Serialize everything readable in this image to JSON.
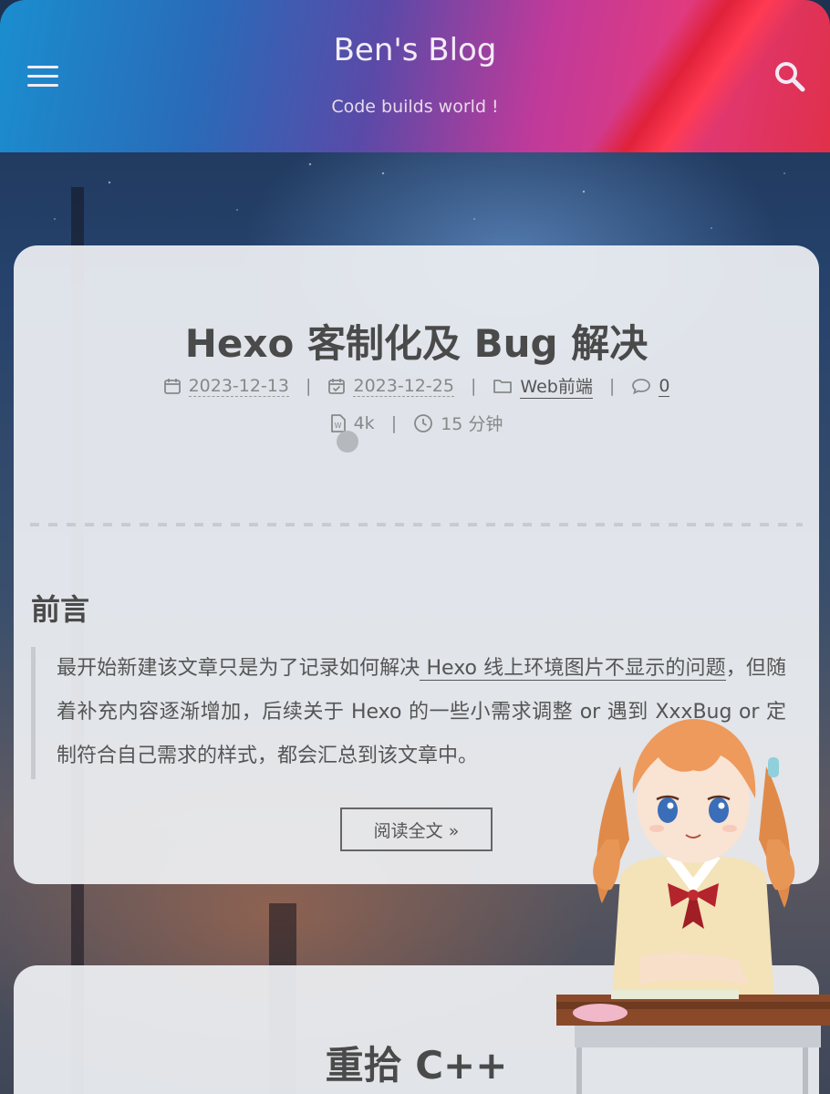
{
  "header": {
    "title": "Ben's Blog",
    "subtitle": "Code builds world !",
    "menu_icon": "hamburger-menu-icon",
    "search_icon": "search-icon",
    "colors": {
      "gradient_start": "#1a8ecf",
      "gradient_mid": "#c03a9a",
      "gradient_end": "#e0304a"
    }
  },
  "posts": [
    {
      "title": "Hexo 客制化及 Bug 解决",
      "meta": {
        "created_icon": "calendar-icon",
        "created": "2023-12-13",
        "updated_icon": "calendar-check-icon",
        "updated": "2023-12-25",
        "category_icon": "folder-icon",
        "category": "Web前端",
        "comments_icon": "comment-icon",
        "comments": "0",
        "separator": "|",
        "wordcount_icon": "word-file-icon",
        "wordcount": "4k",
        "readtime_icon": "clock-icon",
        "readtime": "15 分钟"
      },
      "section_heading": "前言",
      "excerpt_before": "最开始新建该文章只是为了记录如何解决",
      "excerpt_link": " Hexo 线上环境图片不显示的问题",
      "excerpt_after": "，但随着补充内容逐渐增加，后续关于 Hexo 的一些小需求调整 or 遇到 XxxBug or 定制符合自己需求的样式，都会汇总到该文章中。",
      "read_more": "阅读全文 »"
    },
    {
      "title": "重拾 C++"
    }
  ]
}
